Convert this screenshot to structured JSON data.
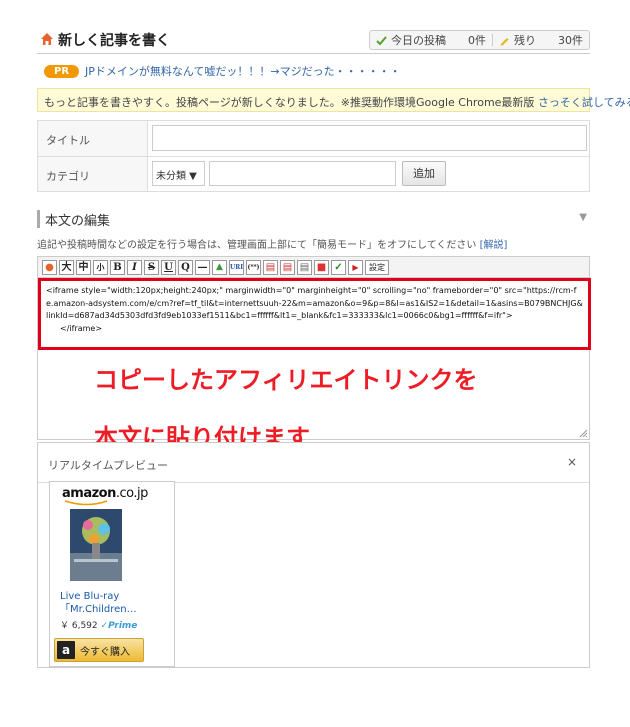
{
  "header": {
    "title": "新しく記事を書く",
    "today_label": "今日の投稿",
    "today_count": "0件",
    "remaining_label": "残り",
    "remaining_count": "30件"
  },
  "pr": {
    "badge": "PR",
    "text": "JPドメインが無料なんて嘘だッ！！！→マジだった・・・・・・"
  },
  "notice": {
    "text": "もっと記事を書きやすく。投稿ページが新しくなりました。※推奨動作環境Google Chrome最新版 ",
    "link": "さっそく試してみる"
  },
  "form": {
    "title_label": "タイトル",
    "title_value": "",
    "category_label": "カテゴリ",
    "category_selected": "未分類 ▼",
    "category_input": "",
    "add_button": "追加"
  },
  "editor": {
    "section_title": "本文の編集",
    "help_text": "追記や投稿時間などの設定を行う場合は、管理画面上部にて「簡易モード」をオフにしてください ",
    "help_link": "[解説]",
    "toolbar": [
      {
        "name": "emoji-button",
        "label": "●"
      },
      {
        "name": "font-large-button",
        "label": "大"
      },
      {
        "name": "font-medium-button",
        "label": "中"
      },
      {
        "name": "font-small-button",
        "label": "小"
      },
      {
        "name": "bold-button",
        "label": "B"
      },
      {
        "name": "italic-button",
        "label": "I"
      },
      {
        "name": "strike-button",
        "label": "S"
      },
      {
        "name": "underline-button",
        "label": "U"
      },
      {
        "name": "quote-button",
        "label": "Q"
      },
      {
        "name": "hr-button",
        "label": "—"
      },
      {
        "name": "image-button",
        "label": "▲"
      },
      {
        "name": "url-button",
        "label": "URL"
      },
      {
        "name": "more-button",
        "label": "(**)"
      },
      {
        "name": "file-button",
        "label": "▤"
      },
      {
        "name": "file-search-button",
        "label": "▤"
      },
      {
        "name": "file-list-button",
        "label": "▤"
      },
      {
        "name": "color-button",
        "label": "■"
      },
      {
        "name": "check-button",
        "label": "✓"
      },
      {
        "name": "video-button",
        "label": "▶"
      }
    ],
    "settings_button": "設定",
    "code": "<iframe style=\"width:120px;height:240px;\" marginwidth=\"0\" marginheight=\"0\" scrolling=\"no\" frameborder=\"0\" src=\"https://rcm-fe.amazon-adsystem.com/e/cm?ref=tf_til&t=internettsuuh-22&m=amazon&o=9&p=8&l=as1&IS2=1&detail=1&asins=B079BNCHJG&linkId=d687ad34d5303dfd3fd9eb1033ef1511&bc1=ffffff&lt1=_blank&fc1=333333&lc1=0066c0&bg1=ffffff&f=ifr\">",
    "code_end": "</iframe>",
    "annotation_line1": "コピーしたアフィリエイトリンクを",
    "annotation_line2": "本文に貼り付けます"
  },
  "preview": {
    "title": "リアルタイムプレビュー",
    "close": "×",
    "amazon_brand": "amazon",
    "amazon_tld": ".co.jp",
    "product_title": "Live Blu-ray 「Mr.Children…",
    "price": "￥ 6,592",
    "prime": "Prime",
    "buy_button": "今すぐ購入"
  },
  "colors": {
    "annotation_red": "#ee1c25",
    "link_blue": "#3366aa",
    "notice_bg": "#fffbd6",
    "pr_orange": "#f39800"
  }
}
